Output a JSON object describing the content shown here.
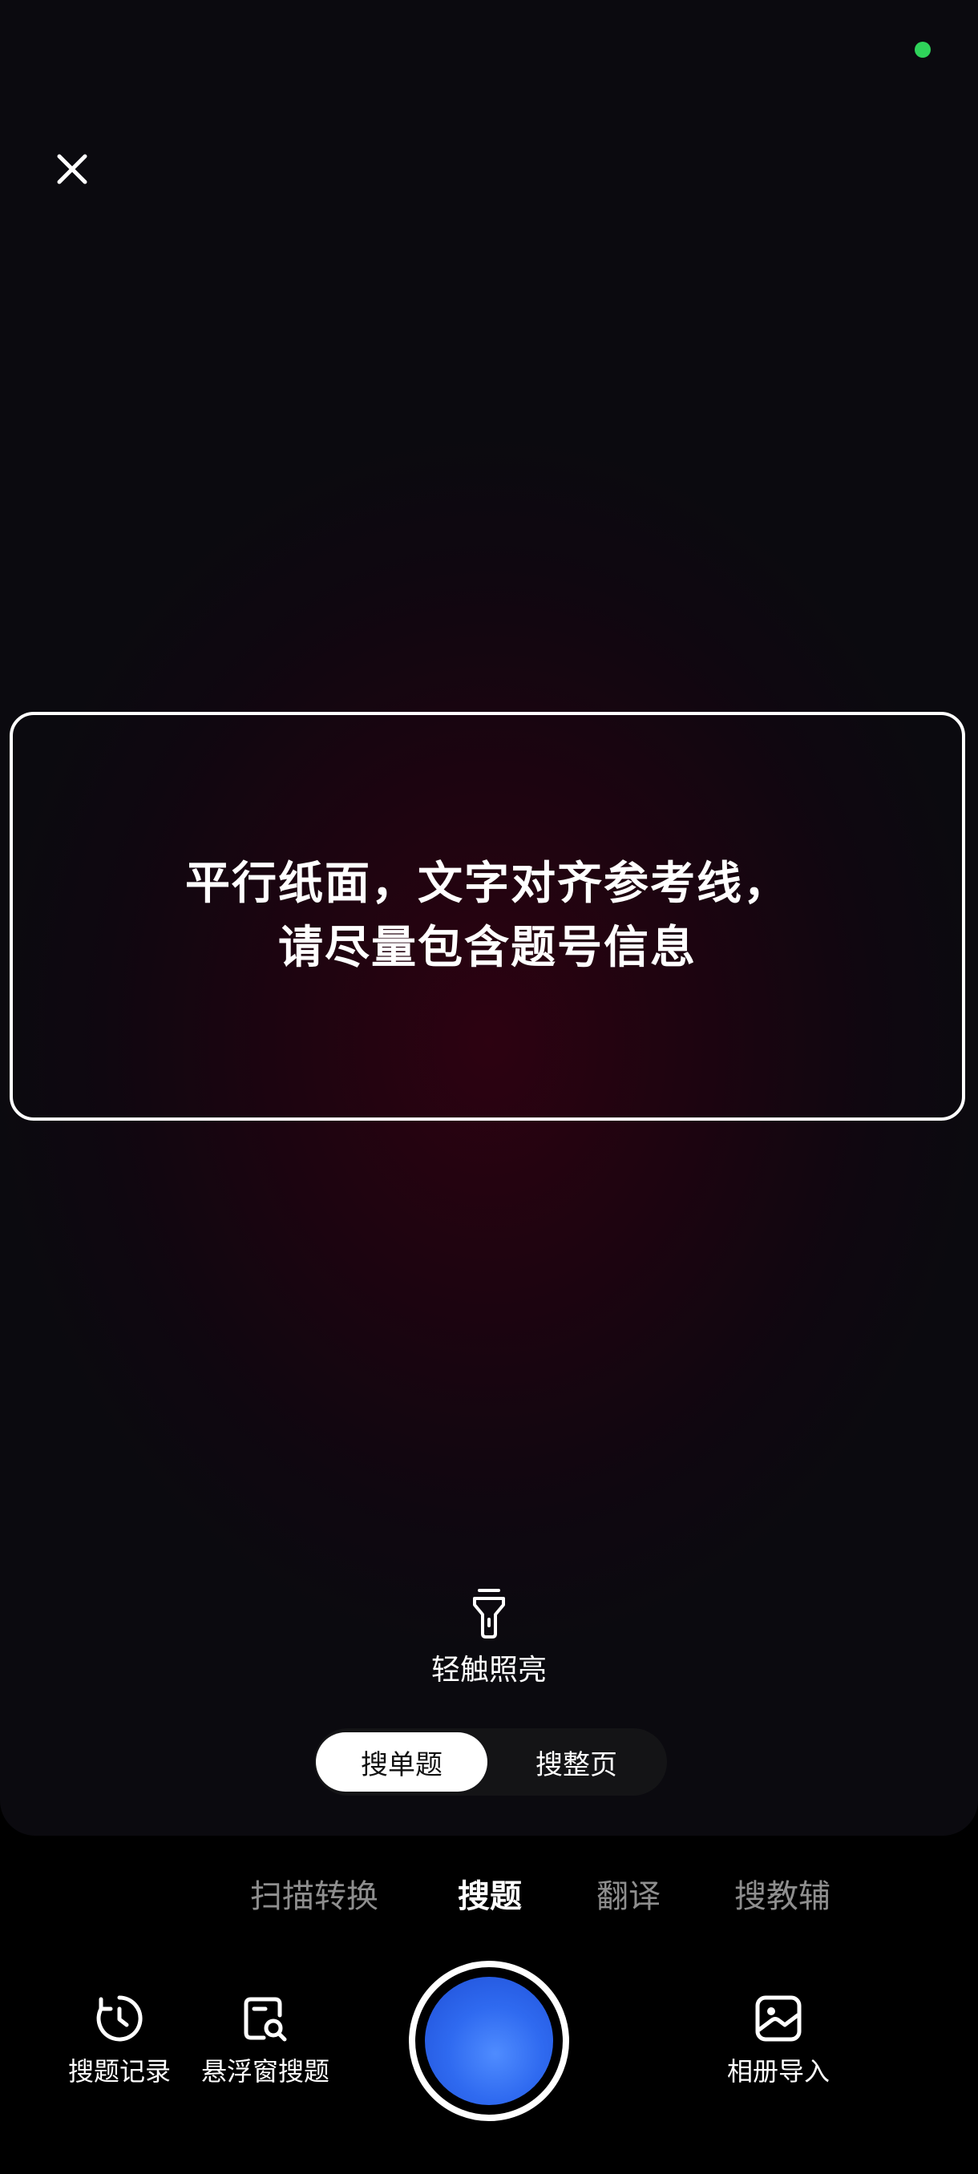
{
  "camera": {
    "hint_line1": "平行纸面，文字对齐参考线，",
    "hint_line2": "请尽量包含题号信息"
  },
  "torch": {
    "label": "轻触照亮",
    "icon": "flashlight-icon"
  },
  "search_scope": {
    "options": [
      "搜单题",
      "搜整页"
    ],
    "selected": "搜单题"
  },
  "mode_tabs": [
    {
      "label": "扫描转换"
    },
    {
      "label": "搜题"
    },
    {
      "label": "翻译"
    },
    {
      "label": "搜教辅"
    }
  ],
  "active_mode": "搜题",
  "bottom_actions": {
    "history_label": "搜题记录",
    "floating_label": "悬浮窗搜题",
    "album_label": "相册导入"
  },
  "colors": {
    "status_indicator": "#2fd35a",
    "shutter_accent": "#2f6af0"
  }
}
